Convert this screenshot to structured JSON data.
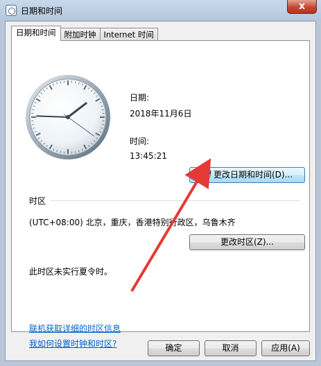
{
  "window": {
    "title": "日期和时间",
    "close_label": "x"
  },
  "tabs": [
    {
      "label": "日期和时间"
    },
    {
      "label": "附加时钟"
    },
    {
      "label": "Internet 时间"
    }
  ],
  "datetime": {
    "date_label": "日期:",
    "date_value": "2018年11月6日",
    "time_label": "时间:",
    "time_value": "13:45:21",
    "change_button": "更改日期和时间(D)..."
  },
  "timezone": {
    "group_label": "时区",
    "value": "(UTC+08:00) 北京，重庆，香港特别行政区，乌鲁木齐",
    "change_button": "更改时区(Z)...",
    "dst_note": "此时区未实行夏令时。"
  },
  "links": {
    "online_info": "联机获取详细的时区信息",
    "how_to": "我如何设置时钟和时区?"
  },
  "footer": {
    "ok": "确定",
    "cancel": "取消",
    "apply": "应用(A)"
  },
  "clock": {
    "hour": 13,
    "minute": 45,
    "second": 21
  },
  "colors": {
    "accent": "#0066cc",
    "annotation_arrow": "#e53935",
    "title_bar": "#c9d9ec"
  }
}
